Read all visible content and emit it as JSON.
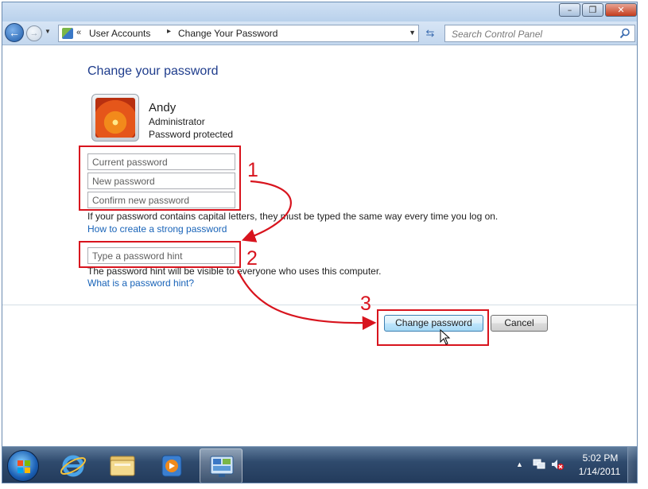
{
  "window": {
    "controls": {
      "minimize": "–",
      "maximize": "❐",
      "close": "✕"
    }
  },
  "navigation": {
    "back_icon": "arrow-left-icon",
    "forward_icon": "arrow-right-icon",
    "breadcrumb_prefix": "«",
    "breadcrumb": [
      "User Accounts",
      "Change Your Password"
    ],
    "breadcrumb_separator": "▸",
    "search_placeholder": "Search Control Panel"
  },
  "main": {
    "title": "Change your password",
    "user": {
      "name": "Andy",
      "role": "Administrator",
      "status": "Password protected"
    },
    "fields": {
      "current_password": "Current password",
      "new_password": "New password",
      "confirm_password": "Confirm new password",
      "password_hint": "Type a password hint"
    },
    "caps_note": "If your password contains capital letters, they must be typed the same way every time you log on.",
    "strong_link": "How to create a strong password",
    "hint_note": "The password hint will be visible to everyone who uses this computer.",
    "hint_link": "What is a password hint?",
    "buttons": {
      "change": "Change password",
      "cancel": "Cancel"
    }
  },
  "annotations": {
    "steps": [
      "1",
      "2",
      "3"
    ],
    "color": "#d8141e"
  },
  "taskbar": {
    "apps": [
      "internet-explorer",
      "windows-explorer",
      "media-player",
      "control-panel"
    ],
    "clock_time": "5:02 PM",
    "clock_date": "1/14/2011"
  },
  "colors": {
    "title_blue": "#1e3c8c",
    "link_blue": "#1863b8",
    "annotation_red": "#d8141e"
  }
}
